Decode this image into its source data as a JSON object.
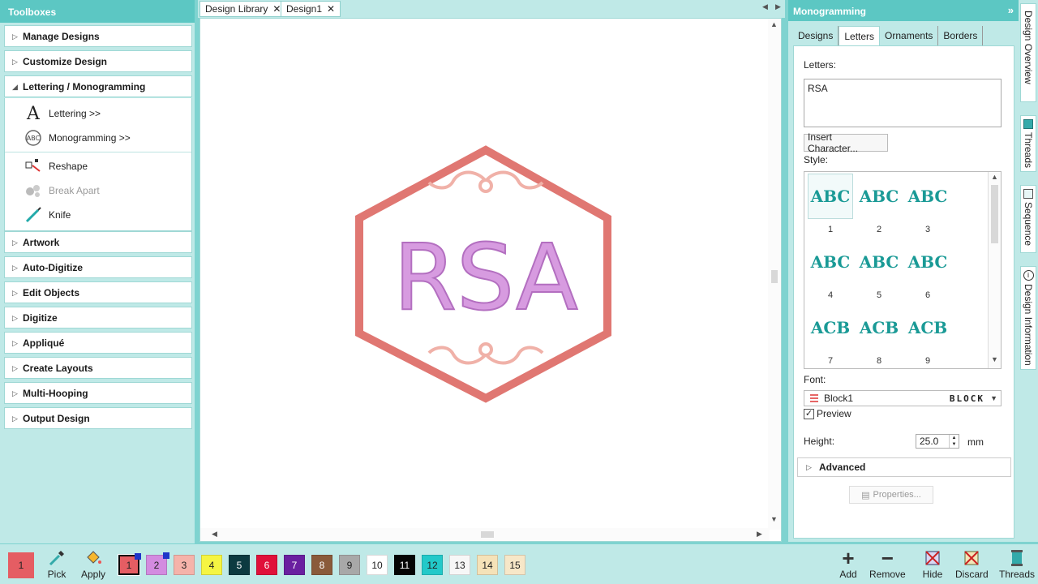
{
  "toolbox": {
    "title": "Toolboxes",
    "sections": {
      "manage": "Manage Designs",
      "customize": "Customize Design",
      "lettering": "Lettering / Monogramming",
      "artwork": "Artwork",
      "autodigitize": "Auto-Digitize",
      "editobjects": "Edit Objects",
      "digitize": "Digitize",
      "applique": "Appliqué",
      "layouts": "Create Layouts",
      "multihooping": "Multi-Hooping",
      "output": "Output Design"
    },
    "lettering_items": {
      "lettering": "Lettering >>",
      "monogramming": "Monogramming >>",
      "reshape": "Reshape",
      "breakapart": "Break Apart",
      "knife": "Knife"
    }
  },
  "doc_tabs": {
    "library": "Design Library",
    "design1": "Design1"
  },
  "canvas": {
    "monogram_text": "RSA",
    "colors": {
      "border": "#e07772",
      "letters": "#d79be0",
      "ornament": "#f0b1a8"
    }
  },
  "panel": {
    "title": "Monogramming",
    "tabs": {
      "designs": "Designs",
      "letters": "Letters",
      "ornaments": "Ornaments",
      "borders": "Borders"
    },
    "letters_label": "Letters:",
    "letters_value": "RSA",
    "insert_char": "Insert Character...",
    "style_label": "Style:",
    "styles": [
      {
        "num": "1",
        "glyph": "ABC"
      },
      {
        "num": "2",
        "glyph": "ABC"
      },
      {
        "num": "3",
        "glyph": "ABC"
      },
      {
        "num": "4",
        "glyph": "ABC"
      },
      {
        "num": "5",
        "glyph": "ABC"
      },
      {
        "num": "6",
        "glyph": "ABC"
      },
      {
        "num": "7",
        "glyph": "ACB"
      },
      {
        "num": "8",
        "glyph": "ACB"
      },
      {
        "num": "9",
        "glyph": "ACB"
      }
    ],
    "font_label": "Font:",
    "font_value": "Block1",
    "font_preview": "BLOCK",
    "preview_label": "Preview",
    "preview_checked": "✓",
    "height_label": "Height:",
    "height_value": "25.0",
    "height_unit": "mm",
    "advanced": "Advanced",
    "properties": "Properties..."
  },
  "side_tabs": {
    "overview": "Design Overview",
    "threads": "Threads",
    "sequence": "Sequence",
    "info": "Design Information"
  },
  "bottom": {
    "pick": "Pick",
    "apply": "Apply",
    "add": "Add",
    "remove": "Remove",
    "hide": "Hide",
    "discard": "Discard",
    "threads": "Threads",
    "first_swatch": "1",
    "swatches": [
      {
        "num": "1",
        "color": "#e55d63",
        "text": "#222"
      },
      {
        "num": "2",
        "color": "#d38be0",
        "text": "#222"
      },
      {
        "num": "3",
        "color": "#f5b3aa",
        "text": "#222"
      },
      {
        "num": "4",
        "color": "#f5f542",
        "text": "#222"
      },
      {
        "num": "5",
        "color": "#0c3a40",
        "text": "#fff"
      },
      {
        "num": "6",
        "color": "#e0103a",
        "text": "#fff"
      },
      {
        "num": "7",
        "color": "#6a1fa0",
        "text": "#fff"
      },
      {
        "num": "8",
        "color": "#8a5a3a",
        "text": "#fff"
      },
      {
        "num": "9",
        "color": "#a8a8a8",
        "text": "#222"
      },
      {
        "num": "10",
        "color": "#ffffff",
        "text": "#222"
      },
      {
        "num": "11",
        "color": "#050505",
        "text": "#fff"
      },
      {
        "num": "12",
        "color": "#22c9c9",
        "text": "#222"
      },
      {
        "num": "13",
        "color": "#f7f7f7",
        "text": "#222"
      },
      {
        "num": "14",
        "color": "#f5e2b8",
        "text": "#222"
      },
      {
        "num": "15",
        "color": "#f7e7c8",
        "text": "#222"
      }
    ]
  }
}
